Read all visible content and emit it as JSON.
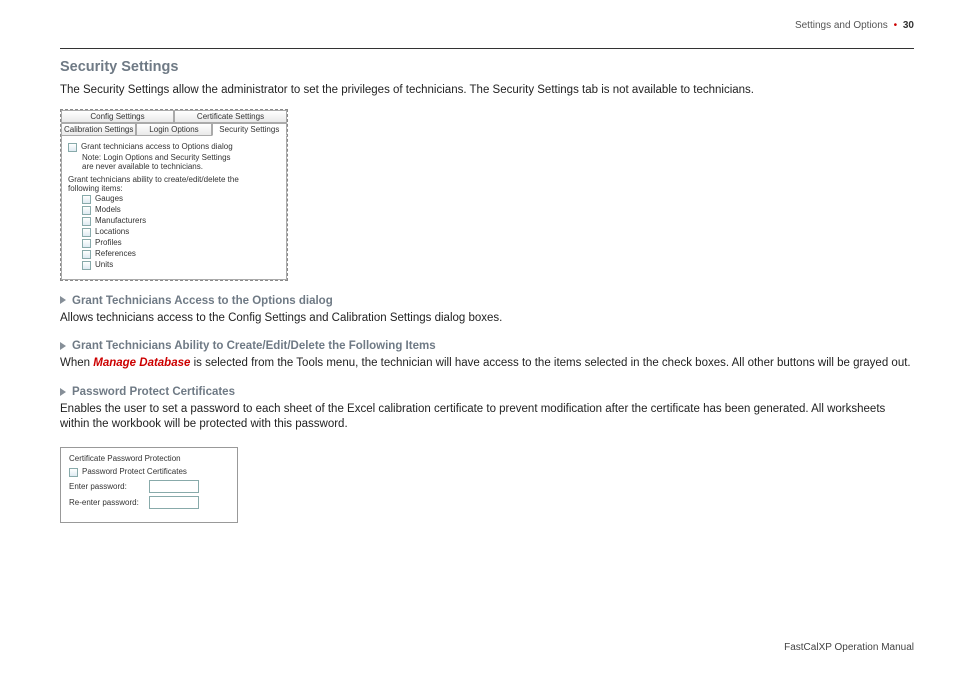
{
  "header": {
    "section": "Settings and Options",
    "page": "30"
  },
  "title": "Security Settings",
  "intro": "The Security Settings allow the administrator to set the privileges of technicians. The Security Settings tab is not available to technicians.",
  "shot1": {
    "tabs_row1": [
      "Config Settings",
      "Certificate Settings"
    ],
    "tabs_row2": [
      "Calibration Settings",
      "Login Options",
      "Security Settings"
    ],
    "active_tab": "Security Settings",
    "grant_access": "Grant technicians access to Options dialog",
    "note1": "Note: Login Options and Security Settings",
    "note2": "are never available to technicians.",
    "grant_ability": "Grant technicians ability to create/edit/delete the",
    "grant_ability2": "following items:",
    "items": [
      "Gauges",
      "Models",
      "Manufacturers",
      "Locations",
      "Profiles",
      "References",
      "Units"
    ]
  },
  "sub1": {
    "title": "Grant Technicians Access to the Options dialog",
    "text": "Allows technicians access to the Config Settings and Calibration Settings dialog boxes."
  },
  "sub2": {
    "title": "Grant Technicians Ability to Create/Edit/Delete the Following Items",
    "pre": "When ",
    "link": "Manage Database",
    "post": " is selected from the Tools menu, the technician will have access to the items selected in the check boxes. All other buttons will be grayed out."
  },
  "sub3": {
    "title": "Password Protect Certificates",
    "text": "Enables the user to set a password to each sheet of the Excel calibration certificate to prevent modification after the certificate has been generated. All work­sheets within the workbook will be protected with this password."
  },
  "shot2": {
    "group": "Certificate Password Protection",
    "ck": "Password Protect Certificates",
    "l1": "Enter password:",
    "l2": "Re-enter password:"
  },
  "footer": "FastCalXP Operation Manual"
}
